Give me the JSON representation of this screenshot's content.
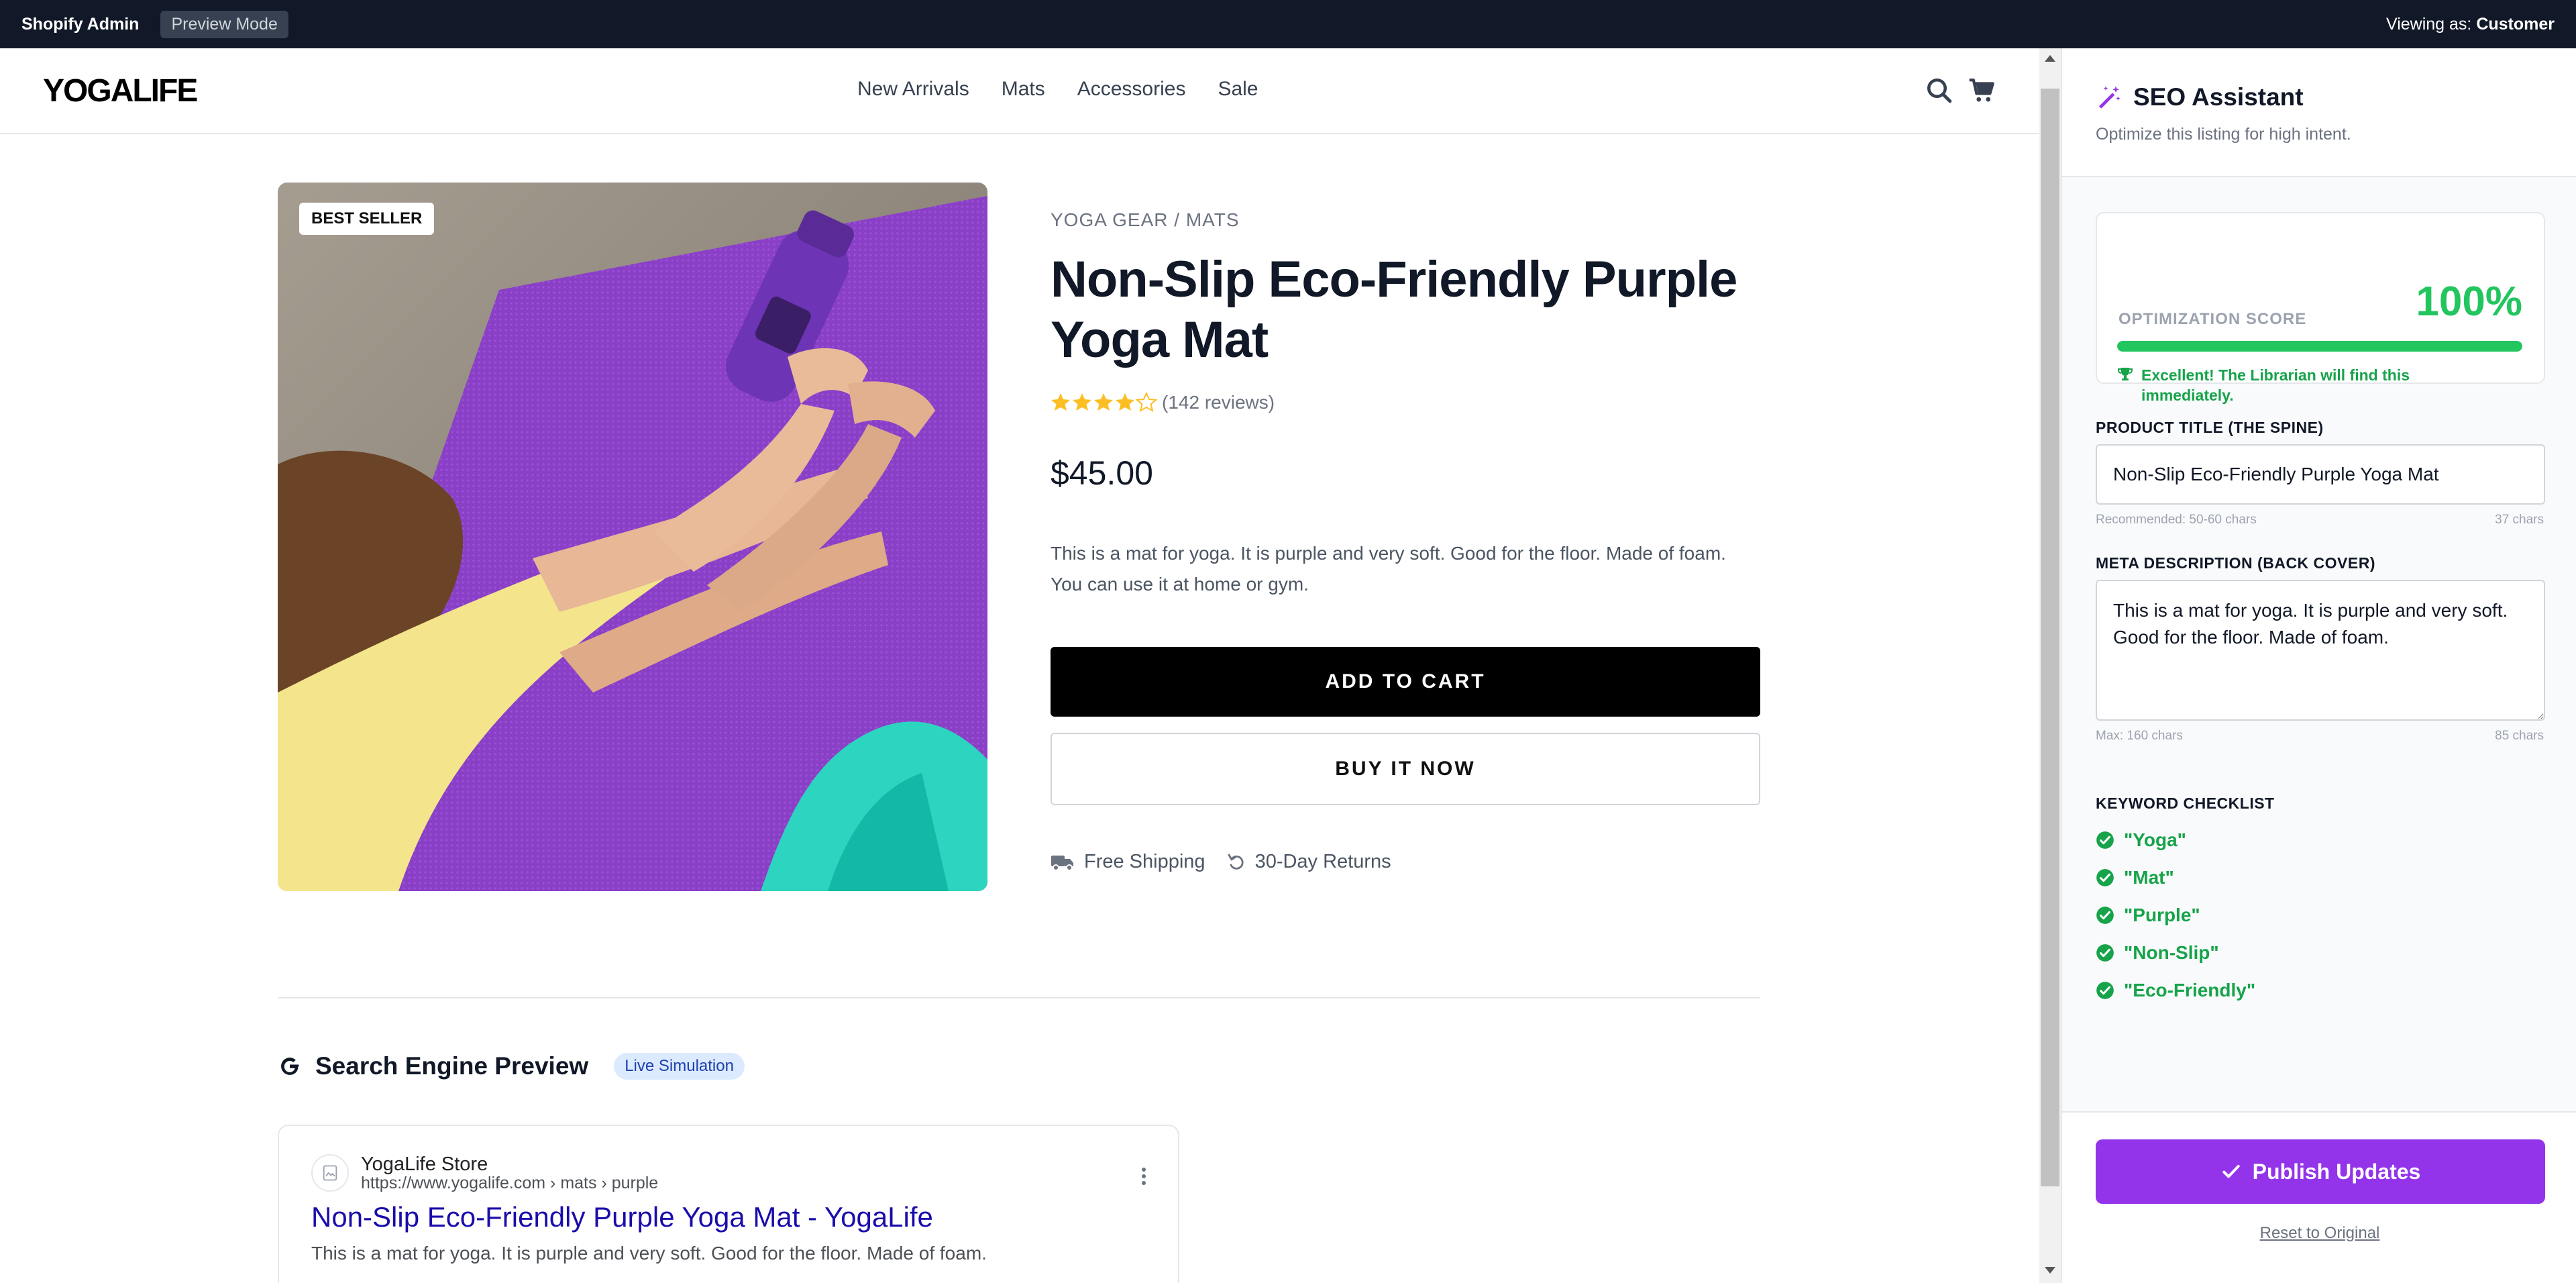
{
  "admin_bar": {
    "brand": "Shopify Admin",
    "mode": "Preview Mode",
    "viewing_prefix": "Viewing as: ",
    "viewing_role": "Customer"
  },
  "store": {
    "logo": "YOGALIFE",
    "nav": [
      "New Arrivals",
      "Mats",
      "Accessories",
      "Sale"
    ],
    "icons": [
      "search-icon",
      "cart-icon"
    ]
  },
  "product": {
    "badge": "BEST SELLER",
    "breadcrumb": "YOGA GEAR / MATS",
    "title": "Non-Slip Eco-Friendly Purple Yoga Mat",
    "rating_value": 4.5,
    "reviews": "(142 reviews)",
    "price": "$45.00",
    "description": "This is a mat for yoga. It is purple and very soft. Good for the floor. Made of foam. You can use it at home or gym.",
    "add_to_cart": "ADD TO CART",
    "buy_now": "BUY IT NOW",
    "perk_shipping": "Free Shipping",
    "perk_returns": "30-Day Returns"
  },
  "serp": {
    "heading": "Search Engine Preview",
    "badge": "Live Simulation",
    "site_name": "YogaLife Store",
    "url": "https://www.yogalife.com › mats › purple",
    "title": "Non-Slip Eco-Friendly Purple Yoga Mat - YogaLife",
    "description": "This is a mat for yoga. It is purple and very soft. Good for the floor. Made of foam."
  },
  "seo": {
    "title": "SEO Assistant",
    "subtitle": "Optimize this listing for high intent.",
    "score_label": "OPTIMIZATION SCORE",
    "score_text": "100%",
    "score_value": 100,
    "score_message": "Excellent! The Librarian will find this immediately.",
    "product_title_label": "PRODUCT TITLE (THE SPINE)",
    "product_title_value": "Non-Slip Eco-Friendly Purple Yoga Mat",
    "product_title_hint": "Recommended: 50-60 chars",
    "product_title_count": "37 chars",
    "meta_label": "META DESCRIPTION (BACK COVER)",
    "meta_value": "This is a mat for yoga. It is purple and very soft. Good for the floor. Made of foam.",
    "meta_hint": "Max: 160 chars",
    "meta_count": "85 chars",
    "keyword_label": "KEYWORD CHECKLIST",
    "keywords": [
      "\"Yoga\"",
      "\"Mat\"",
      "\"Purple\"",
      "\"Non-Slip\"",
      "\"Eco-Friendly\""
    ],
    "publish": "Publish Updates",
    "reset": "Reset to Original"
  },
  "colors": {
    "admin_bg": "#111827",
    "accent_purple": "#9333ea",
    "success_green": "#22c55e",
    "link_blue": "#1a0dab",
    "star": "#fbbf24"
  }
}
